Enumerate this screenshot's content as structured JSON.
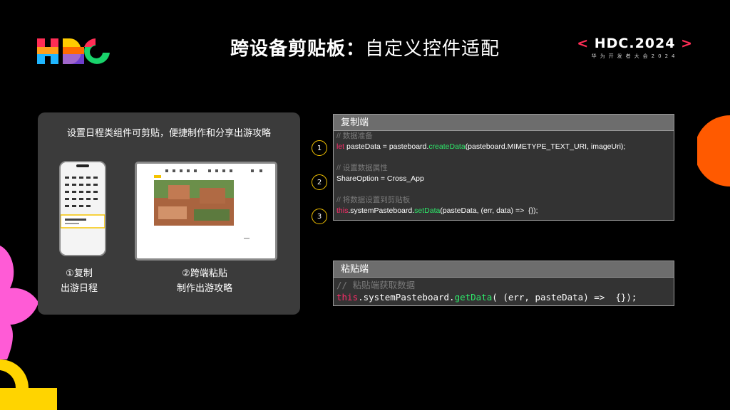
{
  "header": {
    "title_bold": "跨设备剪贴板：",
    "title_rest": "自定义控件适配",
    "brand_left": "<",
    "brand_main": "HDC.2024",
    "brand_right": ">",
    "brand_sub": "华为开发者大会2024"
  },
  "panel": {
    "heading": "设置日程类组件可剪贴，便捷制作和分享出游攻略",
    "captions": [
      {
        "line1": "①复制",
        "line2": "出游日程"
      },
      {
        "line1": "②跨端粘贴",
        "line2": "制作出游攻略"
      }
    ]
  },
  "copy_block": {
    "header": "复制端",
    "markers": [
      "1",
      "2",
      "3"
    ],
    "lines": [
      {
        "comment": "// 数据准备"
      },
      {
        "kw": "let",
        "a": " pasteData = pasteboard.",
        "fn": "createData",
        "b": "(pasteboard.MIMETYPE_TEXT_URI, imageUri);"
      },
      {
        "comment": "// 设置数据属性"
      },
      {
        "a": "ShareOption = Cross_App"
      },
      {
        "comment": "// 将数据设置到剪贴板"
      },
      {
        "kw": "this",
        "a": ".systemPasteboard.",
        "fn": "setData",
        "b": "(pasteData, (err, data) =>  {});"
      }
    ]
  },
  "paste_block": {
    "header": "粘贴端",
    "comment": "// 粘贴端获取数据",
    "kw": "this",
    "a": ".systemPasteboard.",
    "fn": "getData",
    "b": "( (err, pasteData) =>  {});"
  },
  "colors": {
    "accent_red": "#ff2d55",
    "marker_yellow": "#f5c400",
    "keyword": "#ff2d6a",
    "function": "#2ee86a"
  }
}
